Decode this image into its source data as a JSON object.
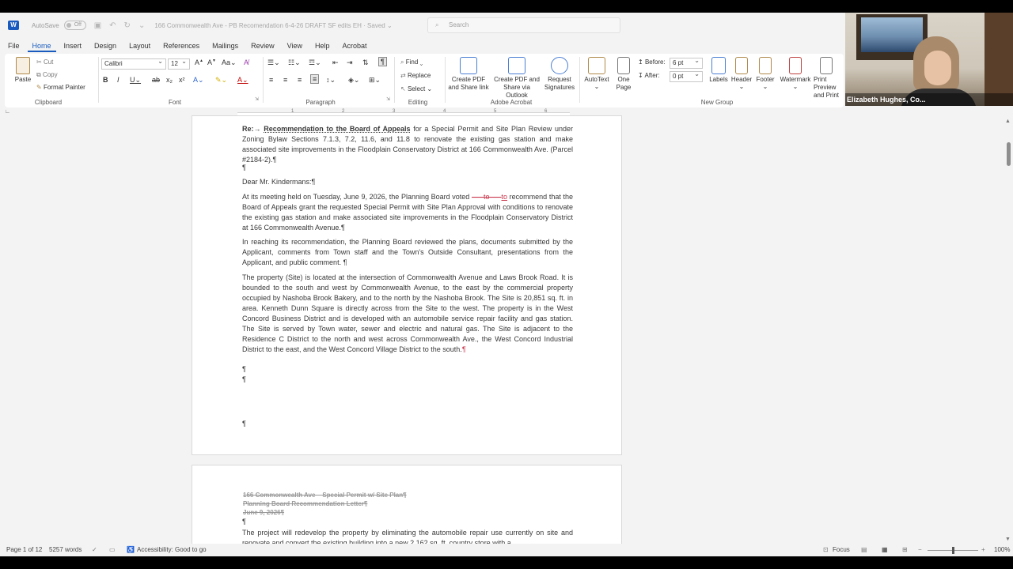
{
  "titlebar": {
    "autosave_label": "AutoSave",
    "autosave_state": "Off",
    "doc_title": "166 Commonwealth Ave - PB Recomendation 6-4-26 DRAFT SF edits EH  ·  Saved ⌄",
    "search_placeholder": "Search",
    "app_icon": "W"
  },
  "tabs": [
    "File",
    "Home",
    "Insert",
    "Design",
    "Layout",
    "References",
    "Mailings",
    "Review",
    "View",
    "Help",
    "Acrobat"
  ],
  "active_tab": "Home",
  "ribbon": {
    "clipboard": {
      "paste": "Paste",
      "cut": "Cut",
      "copy": "Copy",
      "format_painter": "Format Painter",
      "label": "Clipboard"
    },
    "font": {
      "family": "Calibri",
      "size": "12",
      "label": "Font"
    },
    "paragraph": {
      "label": "Paragraph"
    },
    "editing": {
      "find": "Find",
      "replace": "Replace",
      "select": "Select",
      "label": "Editing"
    },
    "acrobat": {
      "create_pdf_share": "Create PDF and Share link",
      "create_pdf_outlook": "Create PDF and Share via Outlook",
      "request_signatures": "Request Signatures",
      "label": "Adobe Acrobat"
    },
    "newgroup": {
      "autotext": "AutoText",
      "one_page": "One Page",
      "before_label": "Before:",
      "before_value": "6 pt",
      "after_label": "After:",
      "after_value": "0 pt",
      "labels": "Labels",
      "header": "Header",
      "footer": "Footer",
      "watermark": "Watermark",
      "print_preview": "Print Preview and Print",
      "label": "New Group"
    }
  },
  "ruler_numbers": [
    "1",
    "2",
    "3",
    "4",
    "5",
    "6"
  ],
  "document": {
    "re_prefix": "Re:",
    "re_arrow": "→",
    "re_bold": "Recommendation to the Board of Appeals",
    "re_rest": " for a Special Permit and Site Plan Review under Zoning Bylaw Sections 7.1.3, 7.2, 11.6, and 11.8 to renovate the existing gas station and make associated site improvements in the Floodplain Conservatory District at 166 Commonwealth Ave. (Parcel #2184-2).",
    "pilcrow": "¶",
    "salutation": "Dear Mr. Kindermans:",
    "para1_a": "At its meeting held on Tuesday, June 9, 2026, the Planning Board voted ",
    "para1_strike": "–––to–––",
    "para1_ins": "to",
    "para1_b": " recommend that the Board of Appeals grant the requested Special Permit with Site Plan Approval with conditions to renovate the existing gas station and make associated site improvements in the Floodplain Conservatory District at 166 Commonwealth Avenue.",
    "para2": "In reaching its recommendation, the Planning Board reviewed the plans, documents submitted by the Applicant, comments from Town staff and the Town's Outside Consultant, presentations from the Applicant, and public comment. ",
    "para3": "The property (Site) is located at the intersection of Commonwealth Avenue and Laws Brook Road. It is bounded to the south and west by Commonwealth Avenue, to the east by the commercial property occupied by Nashoba Brook Bakery, and to the north by the Nashoba Brook. The Site is 20,851 sq. ft. in area. Kenneth Dunn Square is directly across from the Site to the west. The property is in the West Concord Business District and is developed with an automobile service repair facility and gas station. The Site is served by Town water, sewer and electric and natural gas. The Site is adjacent to the Residence C District to the north and west across Commonwealth Ave., the West Concord Industrial District to the east, and the West Concord Village District to the south.",
    "page2_header1": "166 Commonwealth Ave – Special Permit w/ Site Plan",
    "page2_header2": "Planning Board Recommendation Letter",
    "page2_header3": "June 9, 2026",
    "page2_para": "The project will redevelop the property by eliminating the automobile repair use currently on site and renovate and convert the existing building into a new 2,162 sq. ft. country store with a"
  },
  "status": {
    "page": "Page 1 of 12",
    "words": "5257 words",
    "accessibility": "Accessibility: Good to go",
    "focus": "Focus",
    "zoom": "100%"
  },
  "video": {
    "participant_name": "Elizabeth Hughes, Co..."
  },
  "colors": {
    "accent": "#185abd",
    "revision_red": "#c8344a"
  }
}
